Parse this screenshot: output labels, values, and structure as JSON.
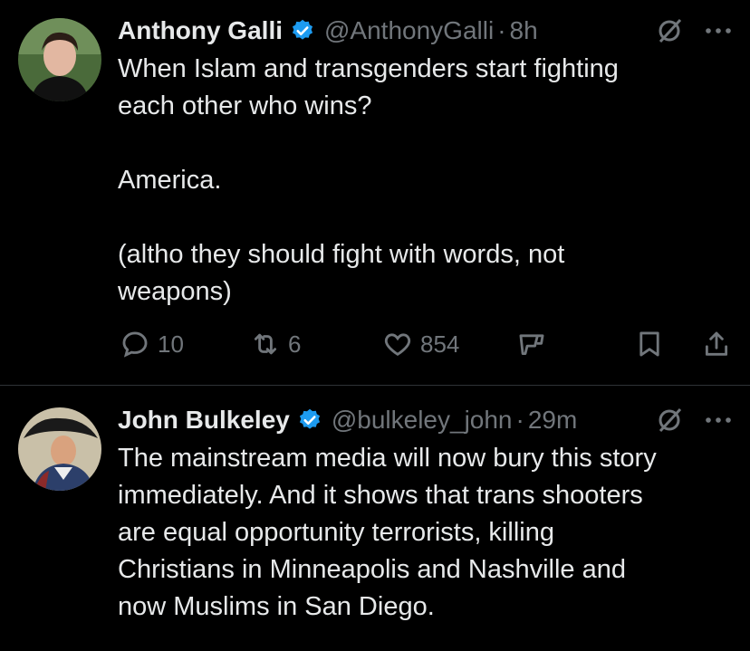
{
  "tweets": [
    {
      "author": "Anthony Galli",
      "handle": "@AnthonyGalli",
      "separator": "·",
      "time": "8h",
      "text": "When Islam and transgenders start fighting\neach other who wins?\n\nAmerica.\n\n(altho they should fight with words, not\nweapons)",
      "metrics": {
        "replies": "10",
        "reposts": "6",
        "likes": "854"
      }
    },
    {
      "author": "John Bulkeley",
      "handle": "@bulkeley_john",
      "separator": "·",
      "time": "29m",
      "text": "The mainstream media will now bury this story\nimmediately. And it shows that trans shooters\nare equal opportunity terrorists, killing\nChristians in Minneapolis and Nashville and\nnow Muslims in San Diego."
    }
  ],
  "colors": {
    "accent": "#1d9bf0",
    "muted": "#71767b",
    "text": "#e7e9ea",
    "background": "#000000"
  },
  "icons": [
    "verified-badge-icon",
    "grok-icon",
    "more-icon",
    "reply-icon",
    "repost-icon",
    "like-icon",
    "analytics-icon",
    "bookmark-icon",
    "share-icon"
  ]
}
